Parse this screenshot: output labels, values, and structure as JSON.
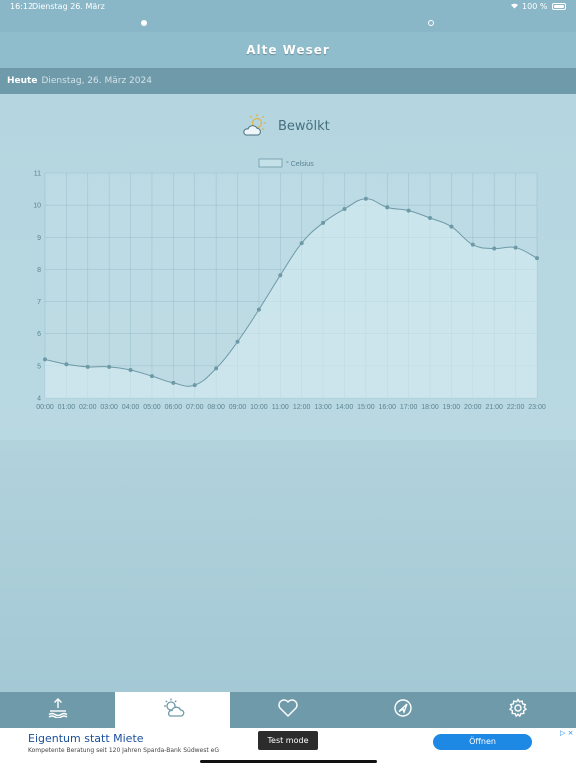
{
  "statusbar": {
    "time": "16:12",
    "date": "Dienstag 26. März",
    "battery": "100 %"
  },
  "pager": {
    "pages": 2,
    "current": 1
  },
  "header": {
    "title": "Alte Weser"
  },
  "datebar": {
    "today": "Heute",
    "date": "Dienstag, 26. März 2024"
  },
  "weather": {
    "icon": "partly-cloudy-icon",
    "condition": "Bewölkt"
  },
  "chart_data": {
    "type": "line",
    "title": "",
    "legend": "° Celsius",
    "legend_position": "top",
    "grid": true,
    "ylim": [
      4,
      11
    ],
    "yticks": [
      "4",
      "5",
      "6",
      "7",
      "8",
      "9",
      "10",
      "11"
    ],
    "categories": [
      "00:00",
      "01:00",
      "02:00",
      "03:00",
      "04:00",
      "05:00",
      "06:00",
      "07:00",
      "08:00",
      "09:00",
      "10:00",
      "11:00",
      "12:00",
      "13:00",
      "14:00",
      "15:00",
      "16:00",
      "17:00",
      "18:00",
      "19:00",
      "20:00",
      "21:00",
      "22:00",
      "23:00"
    ],
    "series": [
      {
        "name": "° Celsius",
        "values": [
          5.2,
          5.05,
          4.97,
          4.97,
          4.87,
          4.68,
          4.47,
          4.4,
          4.92,
          5.75,
          6.75,
          7.82,
          8.82,
          9.45,
          9.88,
          10.2,
          9.93,
          9.83,
          9.6,
          9.33,
          8.77,
          8.65,
          8.68,
          8.35
        ]
      }
    ],
    "line_color": "#6e9aa8"
  },
  "tabs": [
    {
      "icon": "tide-upload-icon",
      "selected": false
    },
    {
      "icon": "weather-sun-cloud-icon",
      "selected": true
    },
    {
      "icon": "heart-icon",
      "selected": false
    },
    {
      "icon": "navigation-icon",
      "selected": false
    },
    {
      "icon": "gear-icon",
      "selected": false
    }
  ],
  "ad": {
    "headline": "Eigentum statt Miete",
    "sub": "Kompetente Beratung seit 120 Jahren Sparda-Bank Südwest eG",
    "test_mode": "Test mode",
    "button": "Öffnen",
    "ad_choice": "▷ ×"
  }
}
